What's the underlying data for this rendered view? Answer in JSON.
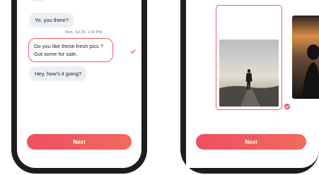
{
  "chat": {
    "messages": [
      {
        "text": "Yo, you there?"
      },
      {
        "timestamp": "Mon, Jul 24, 1:42 PM"
      },
      {
        "text": "Do you like these fresh pics ? Got some for sale."
      },
      {
        "text": "Hey, how's it going?"
      }
    ],
    "next_label": "Next"
  },
  "gallery": {
    "next_label": "Next"
  },
  "colors": {
    "accent": "#ef5d6c",
    "button_start": "#ef4e62",
    "button_end": "#f26a5c",
    "bubble_bg": "#eceff1"
  },
  "icons": [
    "check-icon",
    "check-badge-icon"
  ]
}
